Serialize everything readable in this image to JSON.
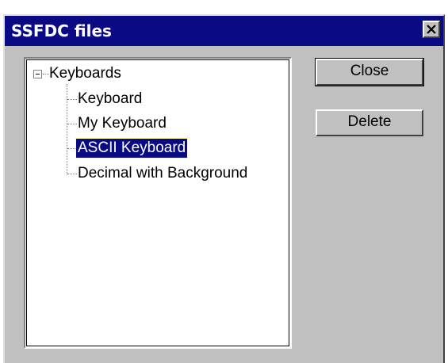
{
  "window": {
    "title": "SSFDC files",
    "close_glyph": "×"
  },
  "tree": {
    "root_label": "Keyboards",
    "children": [
      {
        "label": "Keyboard"
      },
      {
        "label": "My Keyboard"
      },
      {
        "label": "ASCII Keyboard",
        "selected": true
      },
      {
        "label": "Decimal with Background"
      }
    ]
  },
  "buttons": {
    "close_label": "Close",
    "delete_label": "Delete"
  },
  "colors": {
    "titlebar": "#0a0a84",
    "face": "#c0c0c0",
    "selection": "#0a0a84"
  }
}
